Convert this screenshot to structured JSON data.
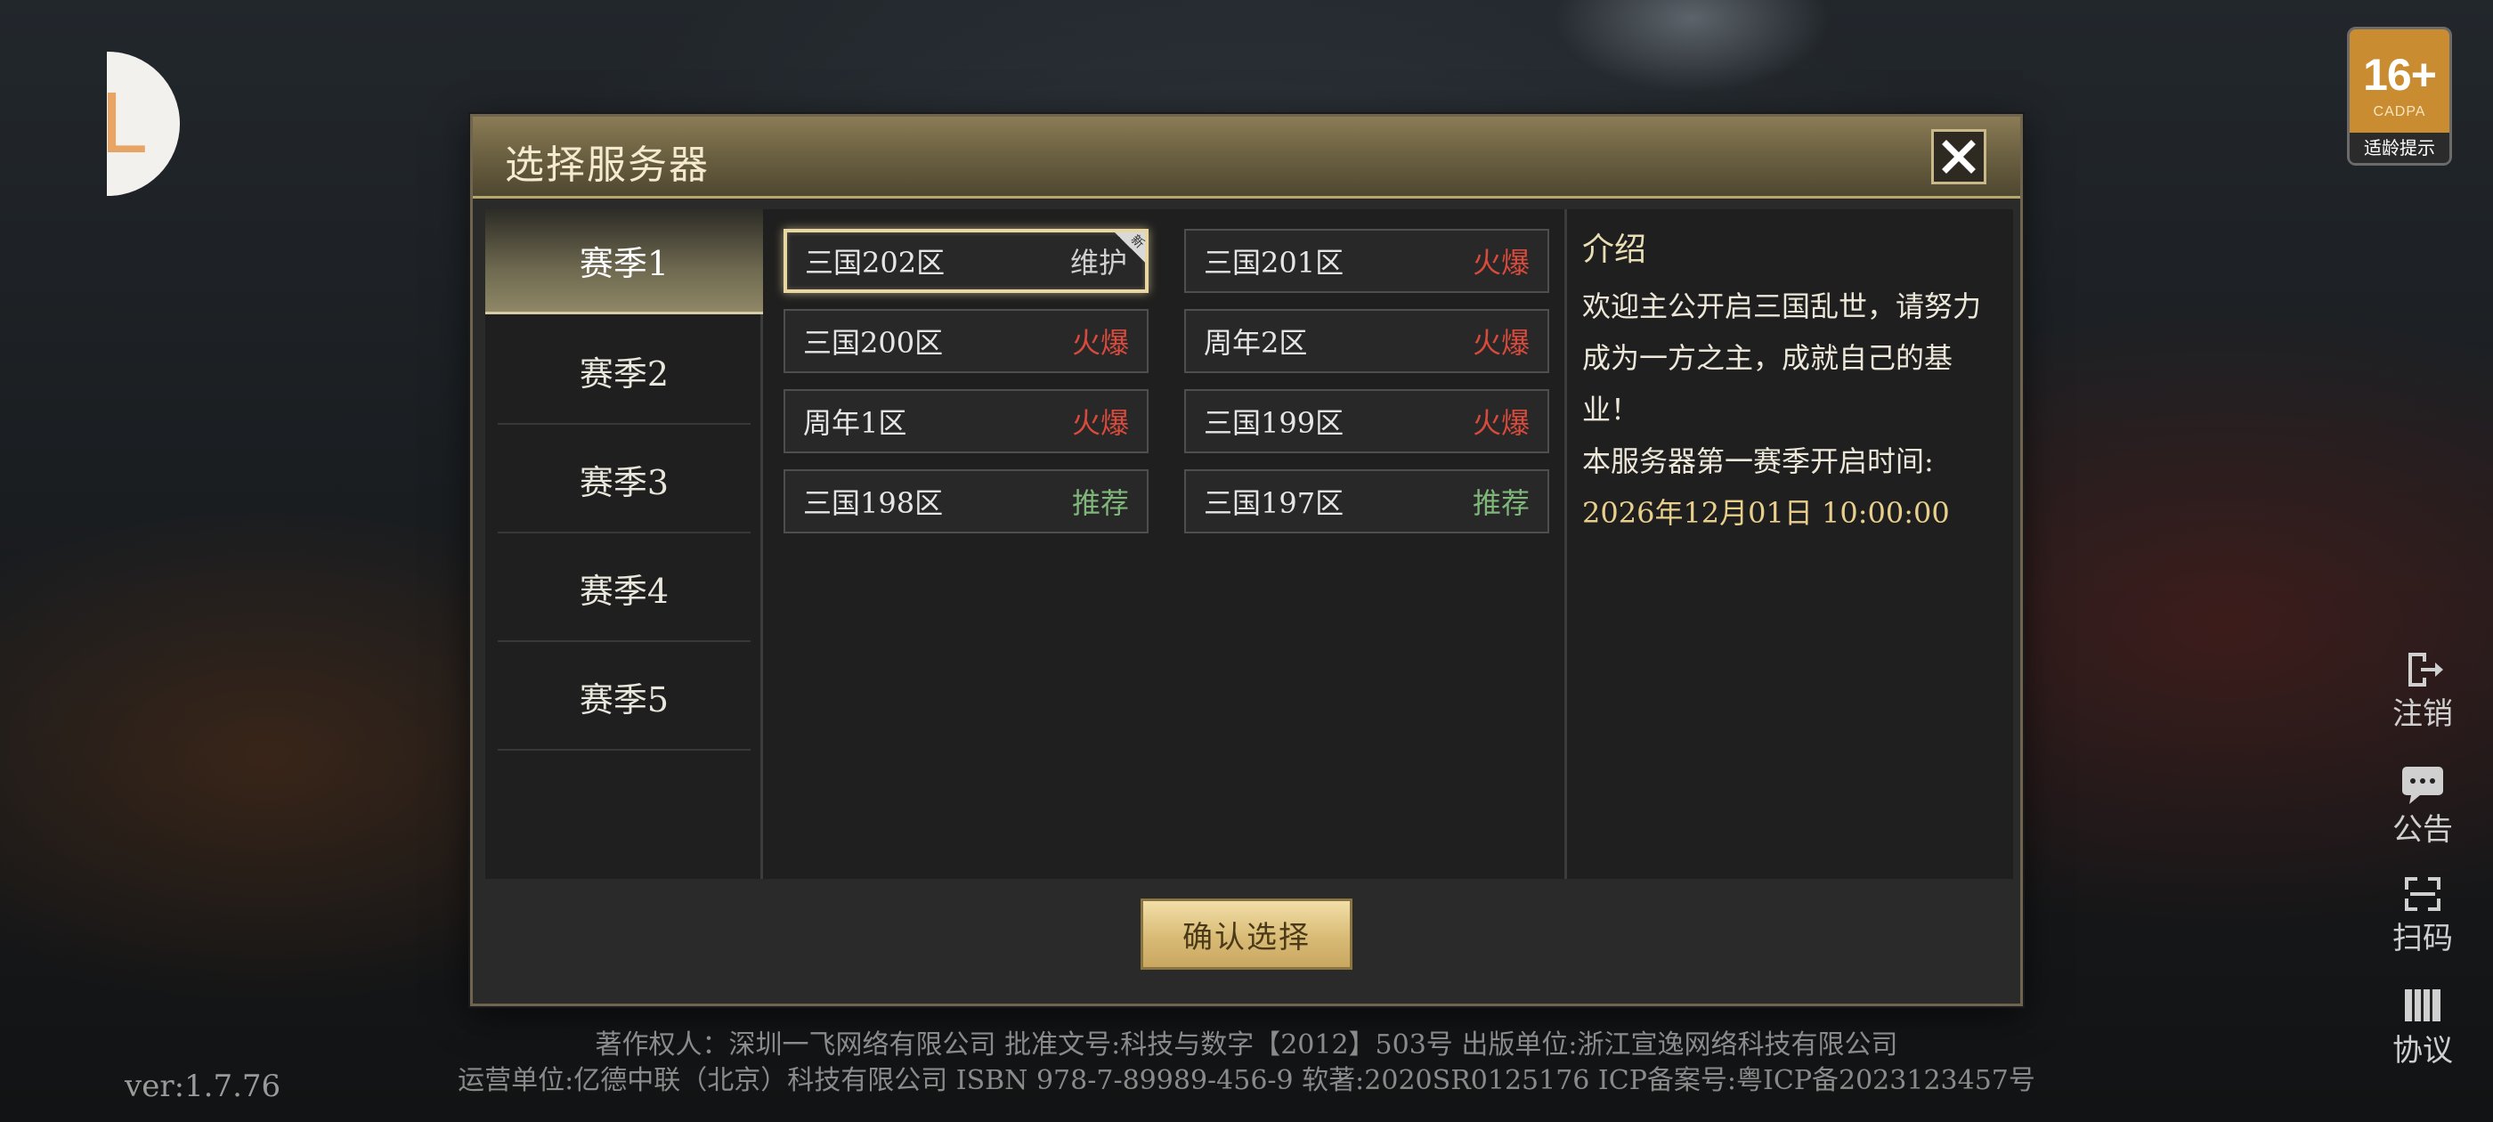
{
  "logo": {
    "glyph": "L"
  },
  "age_badge": {
    "rating": "16+",
    "org": "CADPA",
    "tip": "适龄提示"
  },
  "side_buttons": [
    {
      "label": "注销",
      "icon": "logout-icon"
    },
    {
      "label": "公告",
      "icon": "announcement-icon"
    },
    {
      "label": "扫码",
      "icon": "scan-icon"
    },
    {
      "label": "协议",
      "icon": "agreement-icon"
    }
  ],
  "dialog": {
    "title": "选择服务器",
    "confirm_label": "确认选择",
    "seasons": [
      "赛季1",
      "赛季2",
      "赛季3",
      "赛季4",
      "赛季5"
    ],
    "active_season": "赛季1",
    "servers": [
      {
        "name": "三国202区",
        "status": "维护",
        "status_type": "maint",
        "new_tag": "新",
        "selected": true
      },
      {
        "name": "三国201区",
        "status": "火爆",
        "status_type": "hot"
      },
      {
        "name": "三国200区",
        "status": "火爆",
        "status_type": "hot"
      },
      {
        "name": "周年2区",
        "status": "火爆",
        "status_type": "hot"
      },
      {
        "name": "周年1区",
        "status": "火爆",
        "status_type": "hot"
      },
      {
        "name": "三国199区",
        "status": "火爆",
        "status_type": "hot"
      },
      {
        "name": "三国198区",
        "status": "推荐",
        "status_type": "rec"
      },
      {
        "name": "三国197区",
        "status": "推荐",
        "status_type": "rec"
      }
    ],
    "intro": {
      "title": "介绍",
      "text": "欢迎主公开启三国乱世，请努力成为一方之主，成就自己的基业！",
      "open_label": "本服务器第一赛季开启时间:",
      "open_time": "2026年12月01日 10:00:00"
    }
  },
  "footer": {
    "line1": "著作权人：深圳一飞网络有限公司  批准文号:科技与数字【2012】503号  出版单位:浙江宣逸网络科技有限公司",
    "line2": "运营单位:亿德中联（北京）科技有限公司  ISBN 978-7-89989-456-9  软著:2020SR0125176  ICP备案号:粤ICP备2023123457号"
  },
  "version": "ver:1.7.76"
}
